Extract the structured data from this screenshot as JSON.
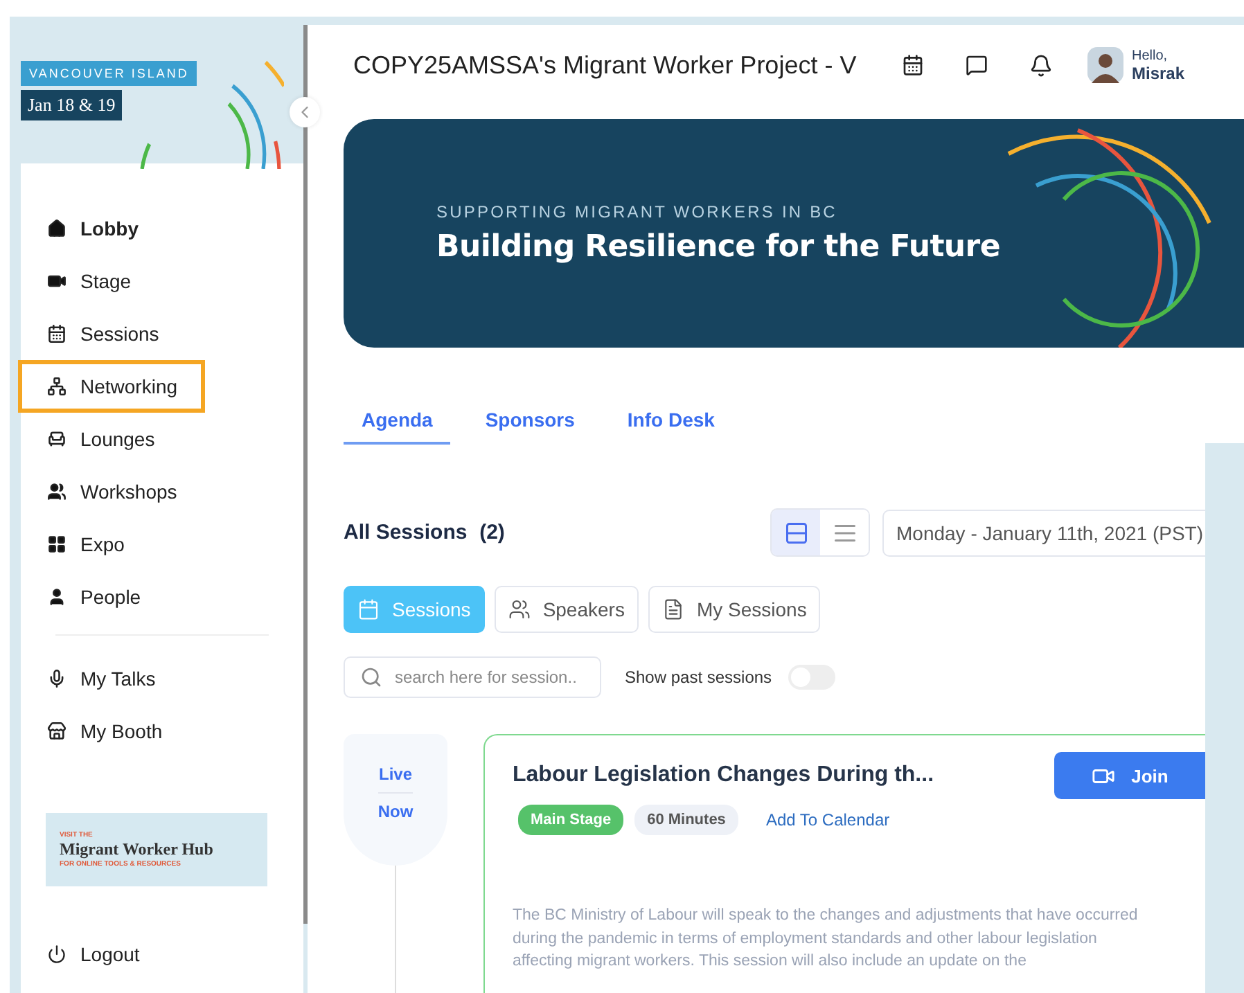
{
  "event": {
    "region": "VANCOUVER ISLAND",
    "dates": "Jan 18 & 19"
  },
  "sidebar": {
    "items": [
      {
        "label": "Lobby",
        "kind": "home",
        "selected": true,
        "highlighted": false
      },
      {
        "label": "Stage",
        "kind": "stage",
        "selected": false,
        "highlighted": false
      },
      {
        "label": "Sessions",
        "kind": "calendar",
        "selected": false,
        "highlighted": false
      },
      {
        "label": "Networking",
        "kind": "network",
        "selected": false,
        "highlighted": true
      },
      {
        "label": "Lounges",
        "kind": "lounge",
        "selected": false,
        "highlighted": false
      },
      {
        "label": "Workshops",
        "kind": "group",
        "selected": false,
        "highlighted": false
      },
      {
        "label": "Expo",
        "kind": "grid",
        "selected": false,
        "highlighted": false
      },
      {
        "label": "People",
        "kind": "person",
        "selected": false,
        "highlighted": false
      }
    ],
    "personal_items": [
      {
        "label": "My Talks",
        "kind": "mic",
        "selected": false,
        "highlighted": false
      },
      {
        "label": "My Booth",
        "kind": "booth",
        "selected": false,
        "highlighted": false
      }
    ],
    "promo": {
      "kicker": "VISIT THE",
      "title": "Migrant Worker Hub",
      "subtitle": "FOR ONLINE TOOLS & RESOURCES"
    },
    "logout": "Logout"
  },
  "header": {
    "title": "COPY25AMSSA's Migrant Worker Project - V",
    "greeting": "Hello,",
    "user": "Misrak"
  },
  "banner": {
    "kicker": "SUPPORTING MIGRANT WORKERS IN BC",
    "title": "Building Resilience for the Future"
  },
  "tabs": [
    {
      "label": "Agenda",
      "selected": true
    },
    {
      "label": "Sponsors",
      "selected": false
    },
    {
      "label": "Info Desk",
      "selected": false
    }
  ],
  "agenda": {
    "heading": "All Sessions",
    "count": "(2)",
    "views": [
      {
        "kind": "cards",
        "selected": true
      },
      {
        "kind": "list",
        "selected": false
      }
    ],
    "date": "Monday - January 11th, 2021 (PST)",
    "filters": [
      {
        "label": "Sessions",
        "kind": "calendar",
        "selected": true
      },
      {
        "label": "Speakers",
        "kind": "people",
        "selected": false
      },
      {
        "label": "My Sessions",
        "kind": "file",
        "selected": false
      }
    ],
    "search": {
      "placeholder": "search here for session.."
    },
    "past_toggle": {
      "label": "Show past sessions",
      "on": false
    },
    "sessions": [
      {
        "status_top": "Live",
        "status_bottom": "Now",
        "title": "Labour Legislation Changes During th...",
        "stage": "Main Stage",
        "duration": "60 Minutes",
        "calendar_link": "Add To Calendar",
        "join": "Join",
        "description": "The BC Ministry of Labour will speak to the changes and adjustments that have occurred during the pandemic in terms of employment standards and other labour legislation affecting migrant workers. This session will also include an update on the"
      }
    ]
  }
}
